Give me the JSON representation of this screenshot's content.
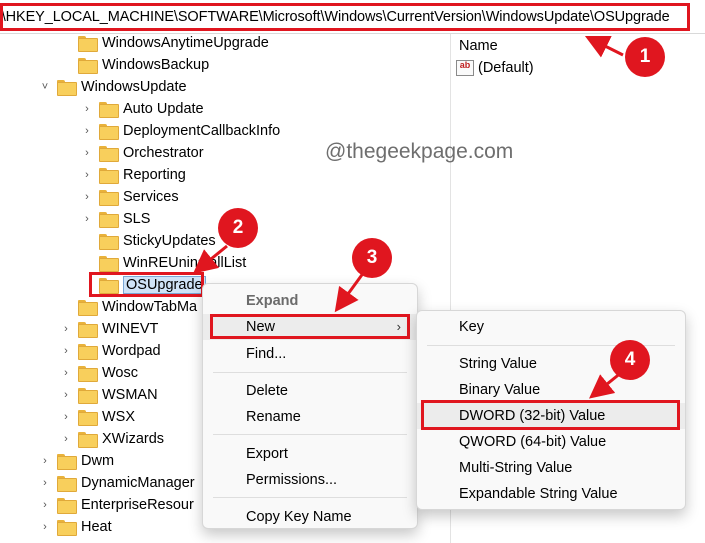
{
  "address_bar": {
    "path": "r\\HKEY_LOCAL_MACHINE\\SOFTWARE\\Microsoft\\Windows\\CurrentVersion\\WindowsUpdate\\OSUpgrade"
  },
  "tree": {
    "items": [
      {
        "label": "WindowsAnytimeUpgrade",
        "chevron": "",
        "selected": false
      },
      {
        "label": "WindowsBackup",
        "chevron": "",
        "selected": false
      },
      {
        "label": "WindowsUpdate",
        "chevron": "˅",
        "selected": false
      },
      {
        "label": "Auto Update",
        "chevron": "›",
        "selected": false
      },
      {
        "label": "DeploymentCallbackInfo",
        "chevron": "›",
        "selected": false
      },
      {
        "label": "Orchestrator",
        "chevron": "›",
        "selected": false
      },
      {
        "label": "Reporting",
        "chevron": "›",
        "selected": false
      },
      {
        "label": "Services",
        "chevron": "›",
        "selected": false
      },
      {
        "label": "SLS",
        "chevron": "›",
        "selected": false
      },
      {
        "label": "StickyUpdates",
        "chevron": "",
        "selected": false
      },
      {
        "label": "WinREUninstallList",
        "chevron": "",
        "selected": false
      },
      {
        "label": "OSUpgrade",
        "chevron": "",
        "selected": true
      },
      {
        "label": "WindowTabMa",
        "chevron": "",
        "selected": false
      },
      {
        "label": "WINEVT",
        "chevron": "›",
        "selected": false
      },
      {
        "label": "Wordpad",
        "chevron": "›",
        "selected": false
      },
      {
        "label": "Wosc",
        "chevron": "›",
        "selected": false
      },
      {
        "label": "WSMAN",
        "chevron": "›",
        "selected": false
      },
      {
        "label": "WSX",
        "chevron": "›",
        "selected": false
      },
      {
        "label": "XWizards",
        "chevron": "›",
        "selected": false
      },
      {
        "label": "Dwm",
        "chevron": "›",
        "selected": false
      },
      {
        "label": "DynamicManager",
        "chevron": "›",
        "selected": false
      },
      {
        "label": "EnterpriseResour",
        "chevron": "›",
        "selected": false
      },
      {
        "label": "Heat",
        "chevron": "›",
        "selected": false
      }
    ]
  },
  "values_pane": {
    "column_name": "Name",
    "default_value": "(Default)",
    "value_icon_text": "ab"
  },
  "watermark": "@thegeekpage.com",
  "context_menu": {
    "expand": "Expand",
    "new": "New",
    "new_arrow": "›",
    "find": "Find...",
    "delete": "Delete",
    "rename": "Rename",
    "export": "Export",
    "permissions": "Permissions...",
    "copy_key_name": "Copy Key Name"
  },
  "submenu": {
    "key": "Key",
    "string_value": "String Value",
    "binary_value": "Binary Value",
    "dword_value": "DWORD (32-bit) Value",
    "qword_value": "QWORD (64-bit) Value",
    "multi_string_value": "Multi-String Value",
    "expandable_string_value": "Expandable String Value"
  },
  "annotations": {
    "step1": "1",
    "step2": "2",
    "step3": "3",
    "step4": "4",
    "color": "#e0161f"
  }
}
